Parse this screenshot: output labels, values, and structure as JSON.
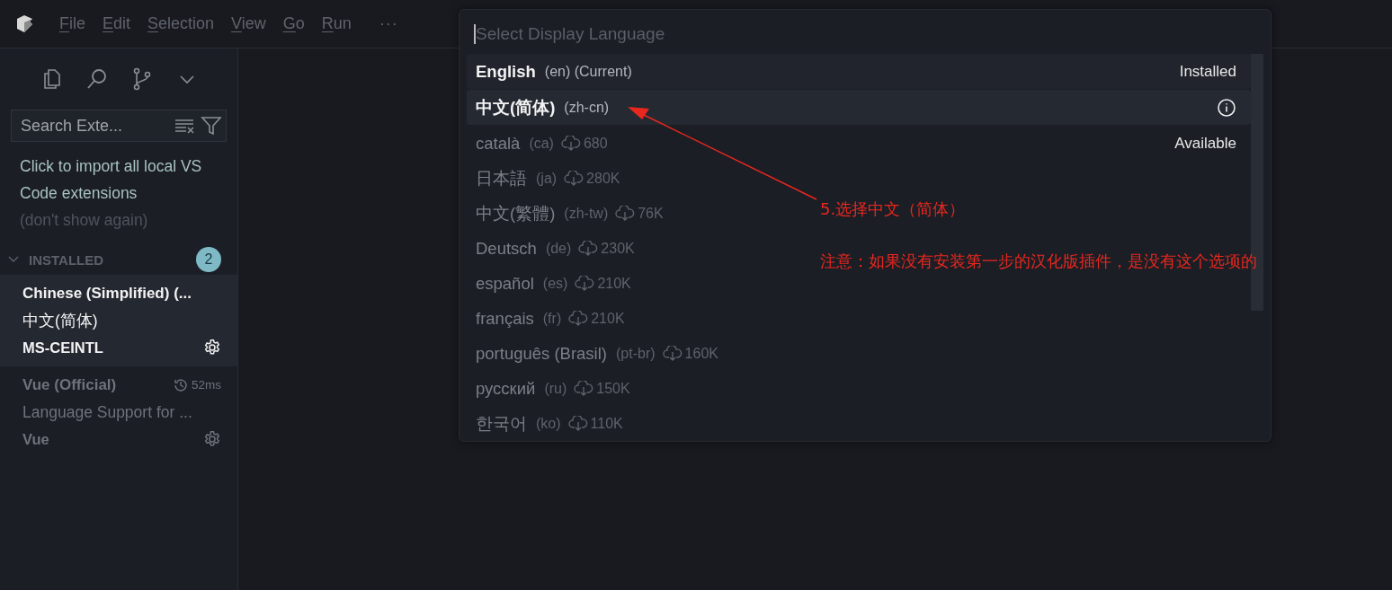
{
  "menu": {
    "items": [
      {
        "label": "File"
      },
      {
        "label": "Edit"
      },
      {
        "label": "Selection"
      },
      {
        "label": "View"
      },
      {
        "label": "Go"
      },
      {
        "label": "Run"
      }
    ],
    "more": "···"
  },
  "sidebar": {
    "search": {
      "placeholder": "Search Exte..."
    },
    "notice": {
      "link": "Click to import all local VS Code extensions",
      "dismiss": "(don't show again)"
    },
    "section": {
      "title": "INSTALLED",
      "expanded": true,
      "count": "2"
    },
    "extensions": [
      {
        "name": "Chinese (Simplified) (...",
        "description": "中文(简体)",
        "publisher": "MS-CEINTL",
        "selected": true
      },
      {
        "name": "Vue (Official)",
        "time": "52ms",
        "description": "Language Support for ...",
        "publisher": "Vue",
        "selected": false
      }
    ]
  },
  "quick_pick": {
    "placeholder": "Select Display Language",
    "items": [
      {
        "kind": "installed",
        "label": "English",
        "detail": "(en) (Current)",
        "group": "Installed",
        "selected": false
      },
      {
        "kind": "installed",
        "label": "中文(简体)",
        "detail": "(zh-cn)",
        "selected": true
      },
      {
        "kind": "available",
        "label": "català",
        "detail": "(ca)",
        "downloads": "680",
        "group": "Available",
        "selected": false
      },
      {
        "kind": "available",
        "label": "日本語",
        "detail": "(ja)",
        "downloads": "280K",
        "selected": false
      },
      {
        "kind": "available",
        "label": "中文(繁體)",
        "detail": "(zh-tw)",
        "downloads": "76K",
        "selected": false
      },
      {
        "kind": "available",
        "label": "Deutsch",
        "detail": "(de)",
        "downloads": "230K",
        "selected": false
      },
      {
        "kind": "available",
        "label": "español",
        "detail": "(es)",
        "downloads": "210K",
        "selected": false
      },
      {
        "kind": "available",
        "label": "français",
        "detail": "(fr)",
        "downloads": "210K",
        "selected": false
      },
      {
        "kind": "available",
        "label": "português (Brasil)",
        "detail": "(pt-br)",
        "downloads": "160K",
        "selected": false
      },
      {
        "kind": "available",
        "label": "русский",
        "detail": "(ru)",
        "downloads": "150K",
        "selected": false
      },
      {
        "kind": "available",
        "label": "한국어",
        "detail": "(ko)",
        "downloads": "110K",
        "selected": false
      }
    ]
  },
  "annotations": [
    {
      "text": "5.选择中文（简体）",
      "color": "#e8271e"
    },
    {
      "text": "注意：如果没有安装第一步的汉化版插件，是没有这个选项的",
      "color": "#e8271e"
    }
  ]
}
